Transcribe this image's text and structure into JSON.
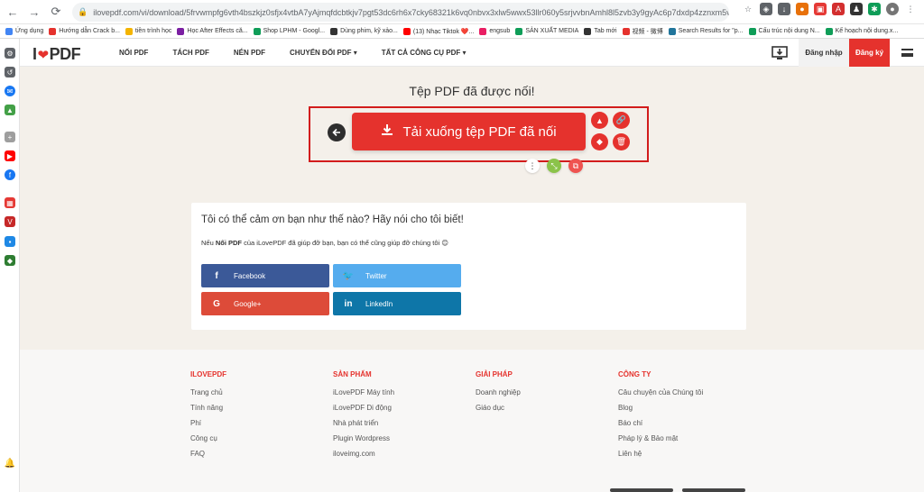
{
  "browser": {
    "url": "ilovepdf.com/vi/download/5frvwmpfg6vth4bszkjz0sfjx4vtbA7yAjmqfdcbtkjv7pgt53dc6rh6x7cky68321k6vq0nbvx3xlw5wwx53llr060y5srjvvbnAmhl8l5zvb3y9gyAc6p7dxdp4zznxm5v05hx0s6qkAbyAylqxlm2...",
    "bookmarks": [
      {
        "label": "Ứng dụng",
        "color": "#4285f4"
      },
      {
        "label": "Hướng dẫn Crack b...",
        "color": "#e5322d"
      },
      {
        "label": "tiền trình học",
        "color": "#f4b400"
      },
      {
        "label": "Học After Effects că...",
        "color": "#7b1fa2"
      },
      {
        "label": "Shop LPHM - Googl...",
        "color": "#0f9d58"
      },
      {
        "label": "Dùng phim, kỹ xảo...",
        "color": "#333333"
      },
      {
        "label": "(13) Nhạc Tiktok ❤️...",
        "color": "#ff0000"
      },
      {
        "label": "engsub",
        "color": "#e91e63"
      },
      {
        "label": "SẢN XUẤT MEDIA",
        "color": "#0f9d58"
      },
      {
        "label": "Tab mới",
        "color": "#333333"
      },
      {
        "label": "视频 - 微博",
        "color": "#e5322d"
      },
      {
        "label": "Search Results for \"p...",
        "color": "#21759b"
      },
      {
        "label": "Cấu trúc nội dung N...",
        "color": "#0f9d58"
      },
      {
        "label": "Kế hoạch nội dung.x...",
        "color": "#0f9d58"
      }
    ]
  },
  "header": {
    "logo_i": "I",
    "logo_pdf": "PDF",
    "nav": [
      "NỐI PDF",
      "TÁCH PDF",
      "NÉN PDF",
      "CHUYỂN ĐỔI PDF ▾",
      "TẤT CẢ CÔNG CỤ PDF ▾"
    ],
    "login": "Đăng nhập",
    "signup": "Đăng ký"
  },
  "main": {
    "success_title": "Tệp PDF đã được nối!",
    "download_label": "Tải xuống tệp PDF đã nối"
  },
  "share": {
    "title": "Tôi có thể cảm ơn bạn như thế nào? Hãy nói cho tôi biết!",
    "desc_prefix": "Nếu ",
    "desc_bold": "Nối PDF",
    "desc_suffix": " của iLovePDF đã giúp đỡ bạn, bạn có thể cũng giúp đỡ chúng tôi 😊",
    "buttons": [
      {
        "label": "Facebook",
        "icon": "f",
        "color": "#3b5998"
      },
      {
        "label": "Twitter",
        "icon": "🐦",
        "color": "#55acee"
      },
      {
        "label": "Google+",
        "icon": "G",
        "color": "#dd4b39"
      },
      {
        "label": "LinkedIn",
        "icon": "in",
        "color": "#0e76a8"
      }
    ]
  },
  "footer": {
    "columns": [
      {
        "head": "ILOVEPDF",
        "links": [
          "Trang chủ",
          "Tính năng",
          "Phí",
          "Công cụ",
          "FAQ"
        ]
      },
      {
        "head": "SẢN PHẨM",
        "links": [
          "iLovePDF Máy tính",
          "iLovePDF Di động",
          "Nhà phát triển",
          "Plugin Wordpress",
          "iloveimg.com"
        ]
      },
      {
        "head": "GIẢI PHÁP",
        "links": [
          "Doanh nghiệp",
          "Giáo dục"
        ]
      },
      {
        "head": "CÔNG TY",
        "links": [
          "Câu chuyện của Chúng tôi",
          "Blog",
          "Báo chí",
          "Pháp lý & Bảo mật",
          "Liên hệ"
        ]
      }
    ]
  },
  "colors": {
    "brand": "#e5322d",
    "highlight_box": "#d21c1c"
  }
}
